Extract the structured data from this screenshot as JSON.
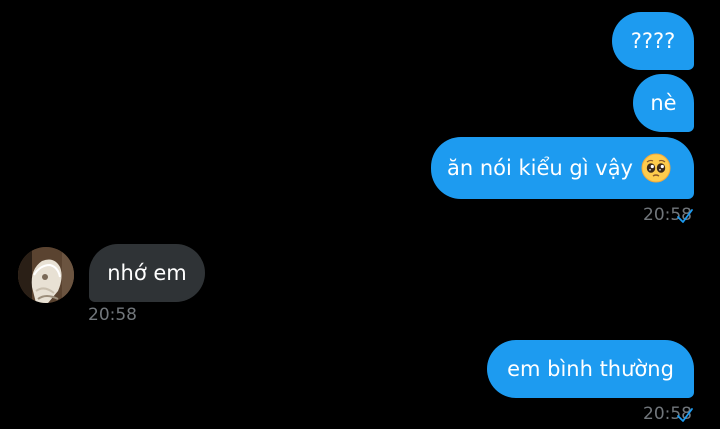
{
  "messages": [
    {
      "text": "????"
    },
    {
      "text": "nè"
    },
    {
      "text": "ăn nói kiểu gì vậy",
      "emoji": "pleading-face"
    },
    {
      "text": "nhớ em"
    },
    {
      "text": "em bình thường"
    }
  ],
  "timestamps": [
    "20:58",
    "20:58",
    "20:58"
  ],
  "colors": {
    "sent_bubble": "#1d9bf0",
    "received_bubble": "#2f3336",
    "timestamp": "#71767b",
    "read_check": "#1d9bf0",
    "background": "#000000"
  }
}
